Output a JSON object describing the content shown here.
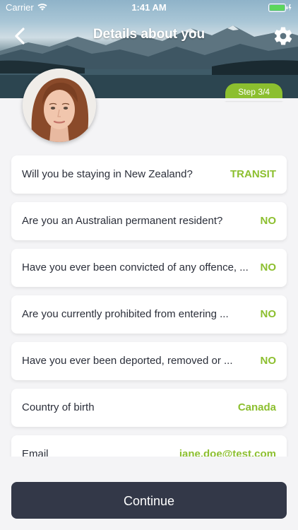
{
  "status_bar": {
    "carrier": "Carrier",
    "time": "1:41 AM"
  },
  "nav": {
    "title": "Details about you",
    "back_icon": "chevron-left-icon",
    "settings_icon": "gear-icon"
  },
  "step": {
    "label": "Step 3/4"
  },
  "profile": {
    "avatar": "profile-photo"
  },
  "questions": [
    {
      "question": "Will you be staying in New Zealand?",
      "answer": "TRANSIT"
    },
    {
      "question": "Are you an Australian permanent resident?",
      "answer": "NO"
    },
    {
      "question": "Have you ever been convicted of any offence, ...",
      "answer": "NO"
    },
    {
      "question": "Are you currently prohibited from entering ...",
      "answer": "NO"
    },
    {
      "question": "Have you ever been deported, removed or ...",
      "answer": "NO"
    },
    {
      "question": "Country of birth",
      "answer": "Canada"
    },
    {
      "question": "Email",
      "answer": "jane.doe@test.com"
    }
  ],
  "footer": {
    "continue_label": "Continue"
  },
  "colors": {
    "accent": "#8cbf2f",
    "button": "#333848",
    "background": "#f4f4f6"
  }
}
